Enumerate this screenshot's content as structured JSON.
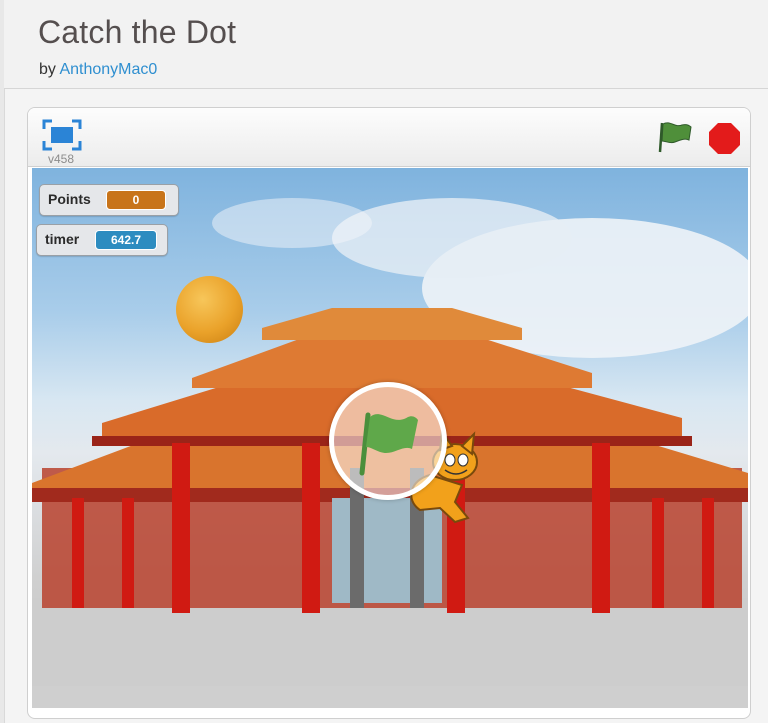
{
  "project": {
    "title": "Catch the Dot",
    "by_label": "by",
    "author": "AnthonyMac0"
  },
  "player": {
    "version": "v458",
    "controls": {
      "fullscreen_icon": "fullscreen-icon",
      "green_flag_icon": "green-flag-icon",
      "stop_icon": "stop-icon"
    }
  },
  "stage": {
    "monitors": [
      {
        "label": "Points",
        "value": "0",
        "color": "#c8741a"
      },
      {
        "label": "timer",
        "value": "642.7",
        "color": "#2d8cc0"
      }
    ],
    "sprites": [
      "orange-dot",
      "scratch-cat"
    ],
    "backdrop": "chinese-temple-gate"
  },
  "colors": {
    "link": "#2f8fd0",
    "flag_green": "#4f8f3a",
    "stop_red": "#e31b1b"
  }
}
